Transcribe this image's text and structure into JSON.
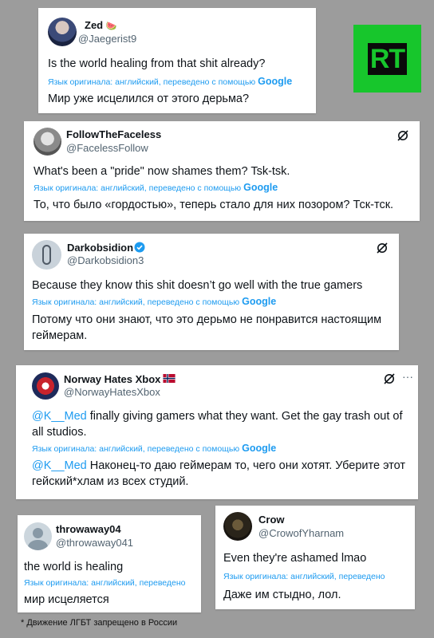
{
  "logo": {
    "text": "RT",
    "color": "#17c62c"
  },
  "translation_label": "Язык оригинала: английский, переведено с помощью",
  "translation_label_short": "Язык оригинала: английский, переведено",
  "google": "Google",
  "tweets": [
    {
      "name": "Zed",
      "name_emoji": "🍉",
      "handle": "@Jaegerist9",
      "text": "Is the world healing from that shit already?",
      "translated": "Мир уже исцелился от этого дерьма?"
    },
    {
      "name": "FollowTheFaceless",
      "handle": "@FacelessFollow",
      "text": "What's been a \"pride\" now shames them? Tsk-tsk.",
      "translated": "То, что было «гордостью», теперь стало для них позором? Тск-тск."
    },
    {
      "name": "Darkobsidion",
      "handle": "@Darkobsidion3",
      "text": "Because they know this shit doesn’t go well  with the true gamers",
      "translated_line1": "Потому что они знают, что это дерьмо не понравится настоящим",
      "translated_line2": "геймерам."
    },
    {
      "name": "Norway Hates Xbox",
      "handle": "@NorwayHatesXbox",
      "mention": "@K__Med",
      "text_line1": " finally giving gamers what they want. Get the gay trash out of",
      "text_line2": "all studios.",
      "translated_line1": " Наконец-то даю геймерам то, чего они хотят. Уберите этот",
      "translated_line2": "гейский*хлам из всех студий.",
      "more": "···"
    },
    {
      "name": "throwaway04",
      "handle": "@throwaway041",
      "text": "the world is healing",
      "translated": "мир исцеляется"
    },
    {
      "name": "Crow",
      "handle": "@CrowofYharnam",
      "text": "Even they're ashamed lmao",
      "translated": "Даже им стыдно, лол."
    }
  ],
  "footnote": "* Движение ЛГБТ запрещено в России"
}
